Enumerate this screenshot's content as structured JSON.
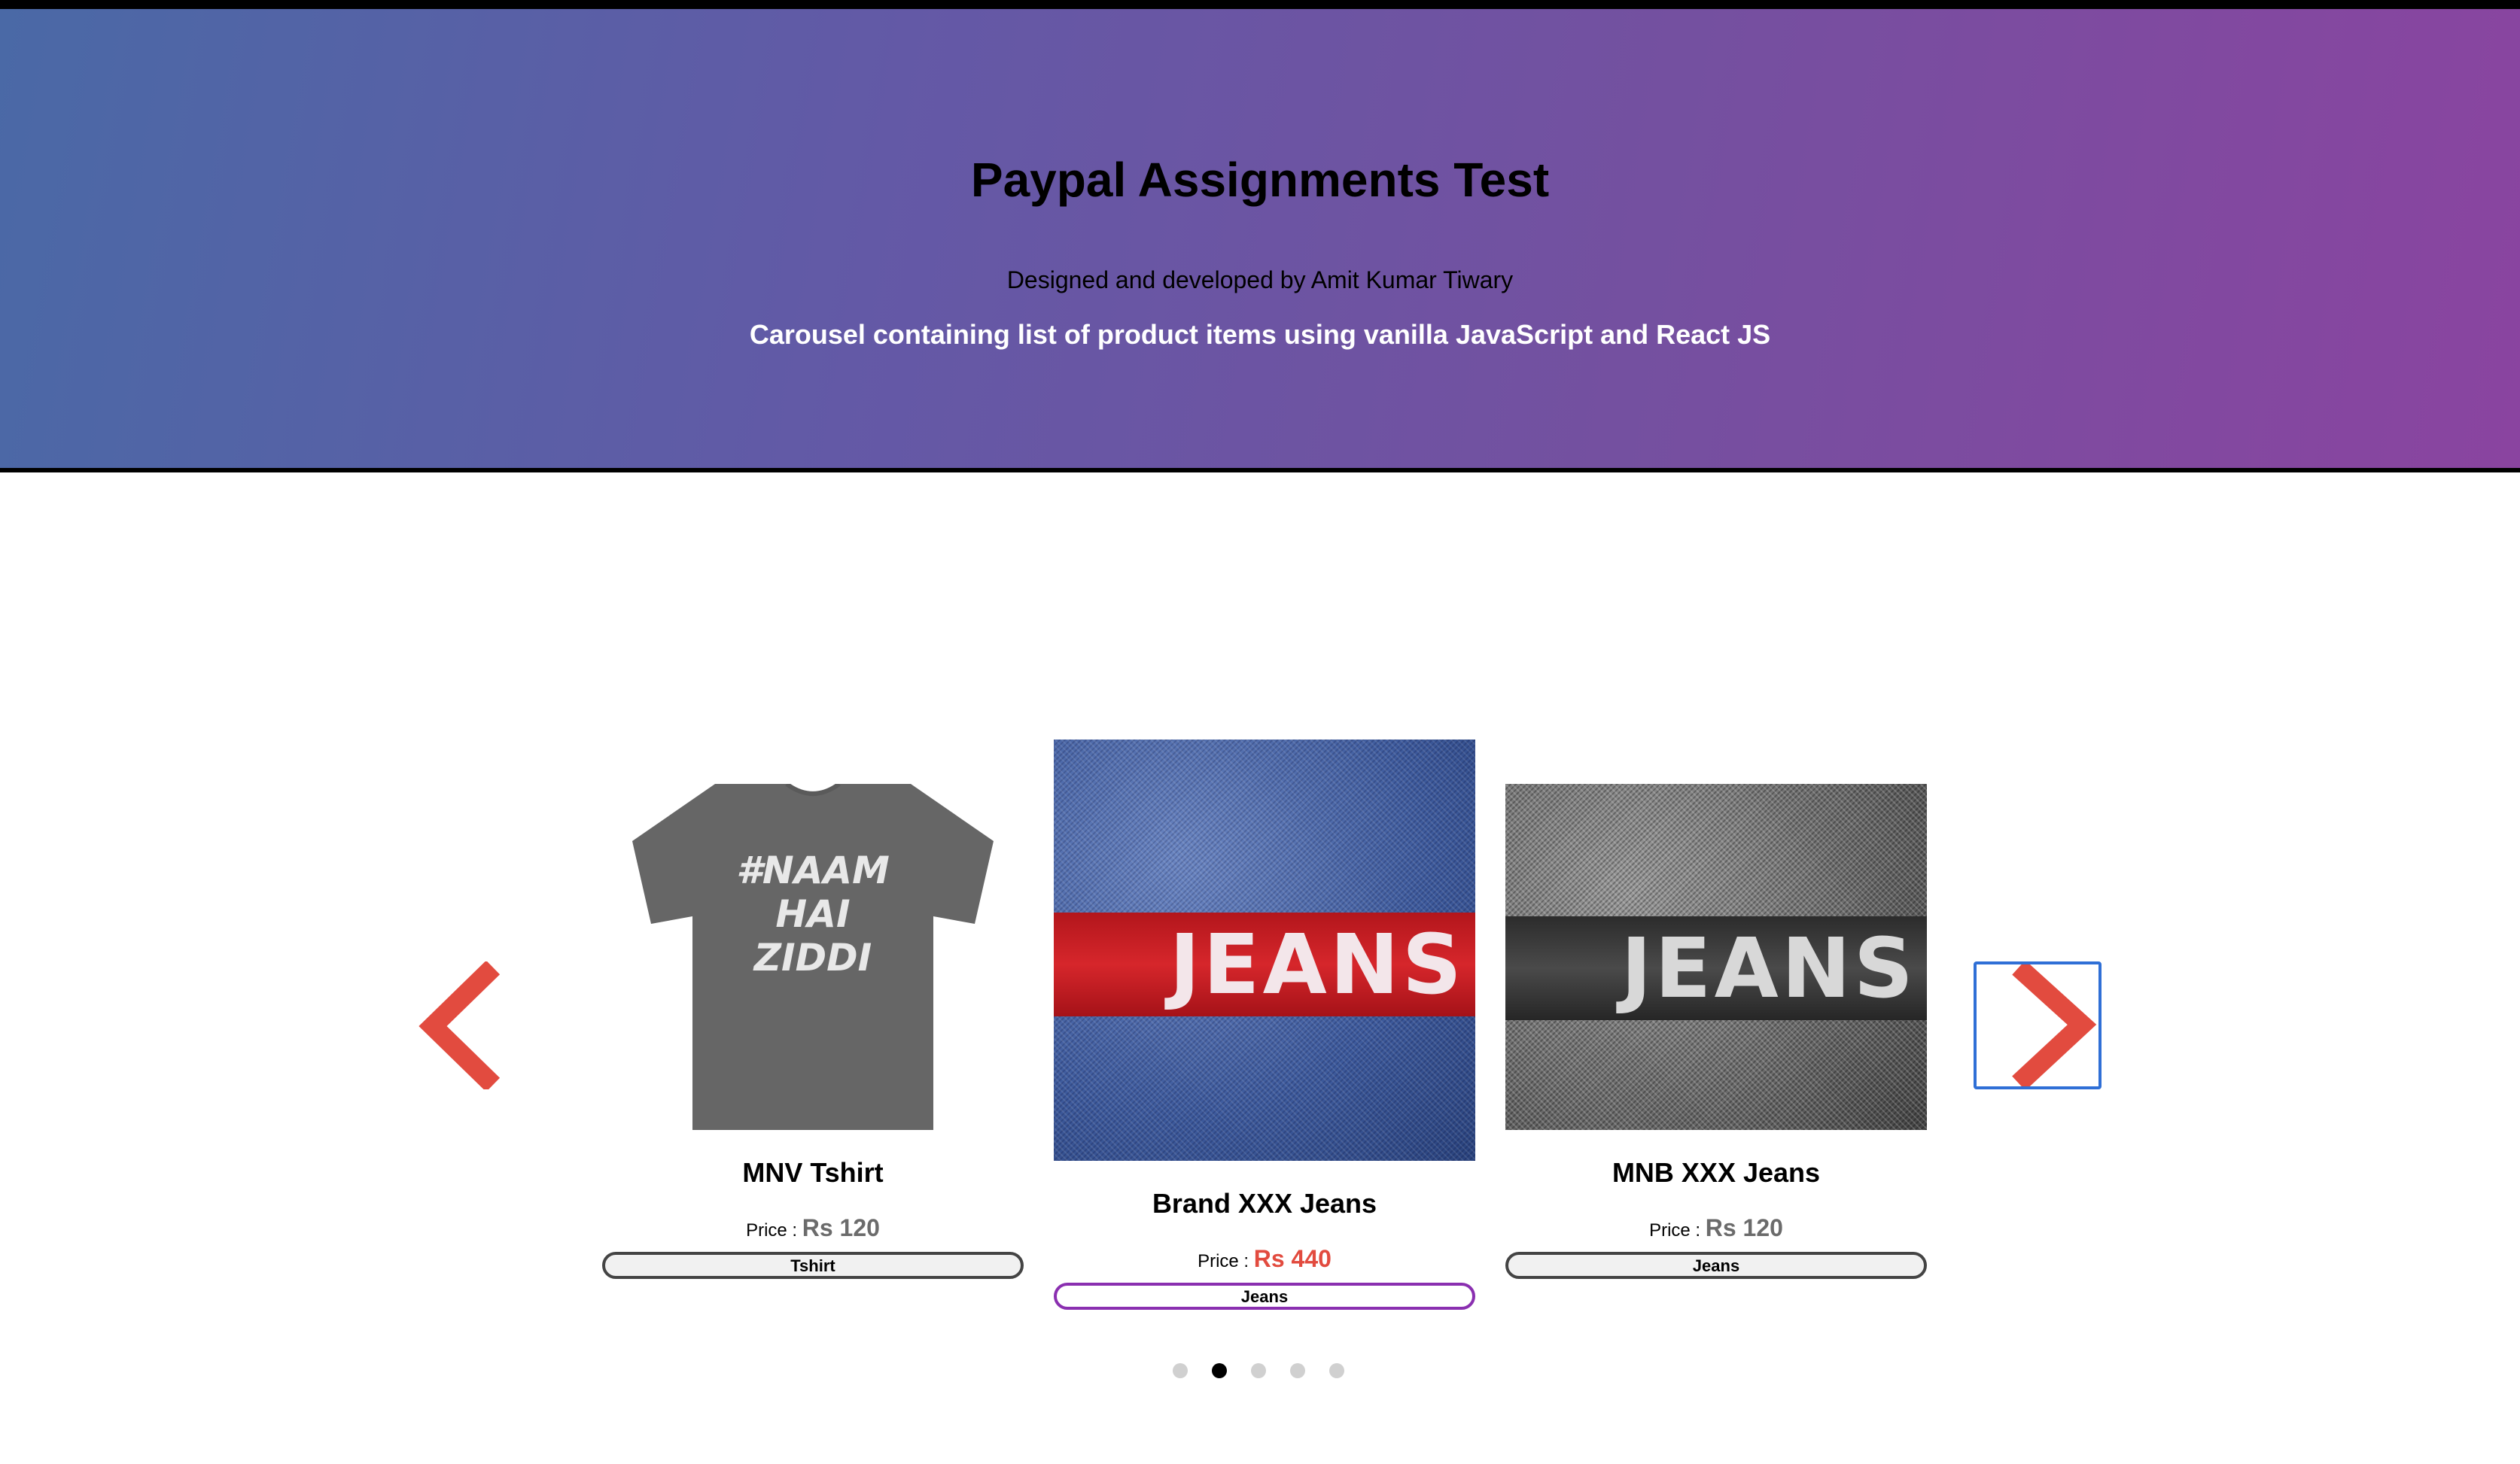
{
  "header": {
    "title": "Paypal Assignments Test",
    "designer": "Designed and developed by Amit Kumar Tiwary",
    "subtitle": "Carousel containing list of product items using vanilla JavaScript and React JS"
  },
  "carousel": {
    "prev_icon": "chevron-left-icon",
    "next_icon": "chevron-right-icon",
    "arrow_color": "#e24b3f",
    "focus_color": "#2f6fd6",
    "active_index": 1,
    "items": [
      {
        "name": "MNV Tshirt",
        "price_label": "Price :",
        "price": "Rs 120",
        "tag": "Tshirt",
        "image_text": [
          "#NAAM",
          "HAI",
          "ZIDDI"
        ]
      },
      {
        "name": "Brand XXX Jeans",
        "price_label": "Price :",
        "price": "Rs 440",
        "tag": "Jeans",
        "image_text": "JEANS"
      },
      {
        "name": "MNB XXX Jeans",
        "price_label": "Price :",
        "price": "Rs 120",
        "tag": "Jeans",
        "image_text": "JEANS"
      }
    ],
    "dots_count": 5,
    "active_dot": 1
  }
}
